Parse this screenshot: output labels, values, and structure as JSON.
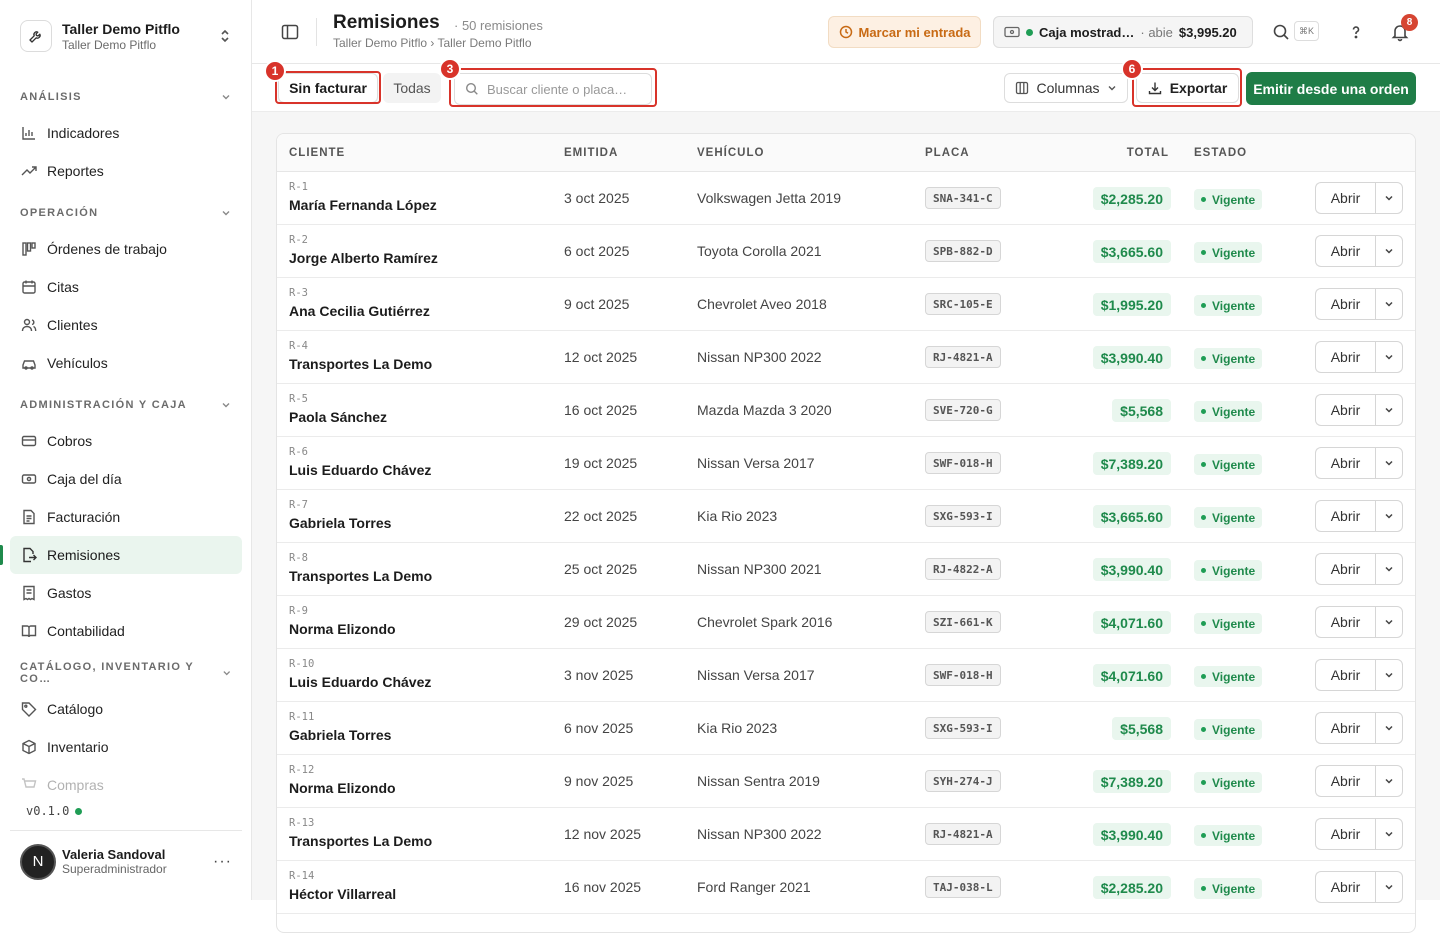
{
  "brand": {
    "name": "Taller Demo Pitflo",
    "sub": "Taller Demo Pitflo"
  },
  "nav": {
    "sections": [
      {
        "title": "ANÁLISIS",
        "items": [
          "Indicadores",
          "Reportes"
        ]
      },
      {
        "title": "OPERACIÓN",
        "items": [
          "Órdenes de trabajo",
          "Citas",
          "Clientes",
          "Vehículos"
        ]
      },
      {
        "title": "ADMINISTRACIÓN Y CAJA",
        "items": [
          "Cobros",
          "Caja del día",
          "Facturación",
          "Remisiones",
          "Gastos",
          "Contabilidad"
        ]
      },
      {
        "title": "CATÁLOGO, INVENTARIO Y CO…",
        "items": [
          "Catálogo",
          "Inventario",
          "Compras"
        ]
      }
    ],
    "active": "Remisiones"
  },
  "version": "v0.1.0",
  "user": {
    "initial": "N",
    "name": "Valeria Sandoval",
    "role": "Superadministrador"
  },
  "header": {
    "title": "Remisiones",
    "count": "50 remisiones",
    "breadcrumb": "Taller Demo Pitflo › Taller Demo Pitflo",
    "entry_button": "Marcar mi entrada",
    "cash_register": "Caja mostrad…",
    "cash_state": "abie",
    "cash_amount": "$3,995.20",
    "kbd_hint": "⌘K",
    "notifications": "8"
  },
  "toolbar": {
    "tab_unbilled": "Sin facturar",
    "tab_all": "Todas",
    "search_placeholder": "Buscar cliente o placa…",
    "columns_button": "Columnas",
    "export_button": "Exportar",
    "emit_button": "Emitir desde una orden"
  },
  "markers": {
    "m1": "1",
    "m3": "3",
    "m6": "6"
  },
  "table": {
    "columns": [
      "CLIENTE",
      "EMITIDA",
      "VEHÍCULO",
      "PLACA",
      "TOTAL",
      "ESTADO"
    ],
    "open_label": "Abrir",
    "rows": [
      {
        "num": "R-1",
        "client": "María Fernanda López",
        "date": "3 oct 2025",
        "vehicle": "Volkswagen Jetta 2019",
        "plate": "SNA-341-C",
        "total": "$2,285.20",
        "status": "Vigente"
      },
      {
        "num": "R-2",
        "client": "Jorge Alberto Ramírez",
        "date": "6 oct 2025",
        "vehicle": "Toyota Corolla 2021",
        "plate": "SPB-882-D",
        "total": "$3,665.60",
        "status": "Vigente"
      },
      {
        "num": "R-3",
        "client": "Ana Cecilia Gutiérrez",
        "date": "9 oct 2025",
        "vehicle": "Chevrolet Aveo 2018",
        "plate": "SRC-105-E",
        "total": "$1,995.20",
        "status": "Vigente"
      },
      {
        "num": "R-4",
        "client": "Transportes La Demo",
        "date": "12 oct 2025",
        "vehicle": "Nissan NP300 2022",
        "plate": "RJ-4821-A",
        "total": "$3,990.40",
        "status": "Vigente"
      },
      {
        "num": "R-5",
        "client": "Paola Sánchez",
        "date": "16 oct 2025",
        "vehicle": "Mazda Mazda 3 2020",
        "plate": "SVE-720-G",
        "total": "$5,568",
        "status": "Vigente"
      },
      {
        "num": "R-6",
        "client": "Luis Eduardo Chávez",
        "date": "19 oct 2025",
        "vehicle": "Nissan Versa 2017",
        "plate": "SWF-018-H",
        "total": "$7,389.20",
        "status": "Vigente"
      },
      {
        "num": "R-7",
        "client": "Gabriela Torres",
        "date": "22 oct 2025",
        "vehicle": "Kia Rio 2023",
        "plate": "SXG-593-I",
        "total": "$3,665.60",
        "status": "Vigente"
      },
      {
        "num": "R-8",
        "client": "Transportes La Demo",
        "date": "25 oct 2025",
        "vehicle": "Nissan NP300 2021",
        "plate": "RJ-4822-A",
        "total": "$3,990.40",
        "status": "Vigente"
      },
      {
        "num": "R-9",
        "client": "Norma Elizondo",
        "date": "29 oct 2025",
        "vehicle": "Chevrolet Spark 2016",
        "plate": "SZI-661-K",
        "total": "$4,071.60",
        "status": "Vigente"
      },
      {
        "num": "R-10",
        "client": "Luis Eduardo Chávez",
        "date": "3 nov 2025",
        "vehicle": "Nissan Versa 2017",
        "plate": "SWF-018-H",
        "total": "$4,071.60",
        "status": "Vigente"
      },
      {
        "num": "R-11",
        "client": "Gabriela Torres",
        "date": "6 nov 2025",
        "vehicle": "Kia Rio 2023",
        "plate": "SXG-593-I",
        "total": "$5,568",
        "status": "Vigente"
      },
      {
        "num": "R-12",
        "client": "Norma Elizondo",
        "date": "9 nov 2025",
        "vehicle": "Nissan Sentra 2019",
        "plate": "SYH-274-J",
        "total": "$7,389.20",
        "status": "Vigente"
      },
      {
        "num": "R-13",
        "client": "Transportes La Demo",
        "date": "12 nov 2025",
        "vehicle": "Nissan NP300 2022",
        "plate": "RJ-4821-A",
        "total": "$3,990.40",
        "status": "Vigente"
      },
      {
        "num": "R-14",
        "client": "Héctor Villarreal",
        "date": "16 nov 2025",
        "vehicle": "Ford Ranger 2021",
        "plate": "TAJ-038-L",
        "total": "$2,285.20",
        "status": "Vigente"
      }
    ]
  }
}
